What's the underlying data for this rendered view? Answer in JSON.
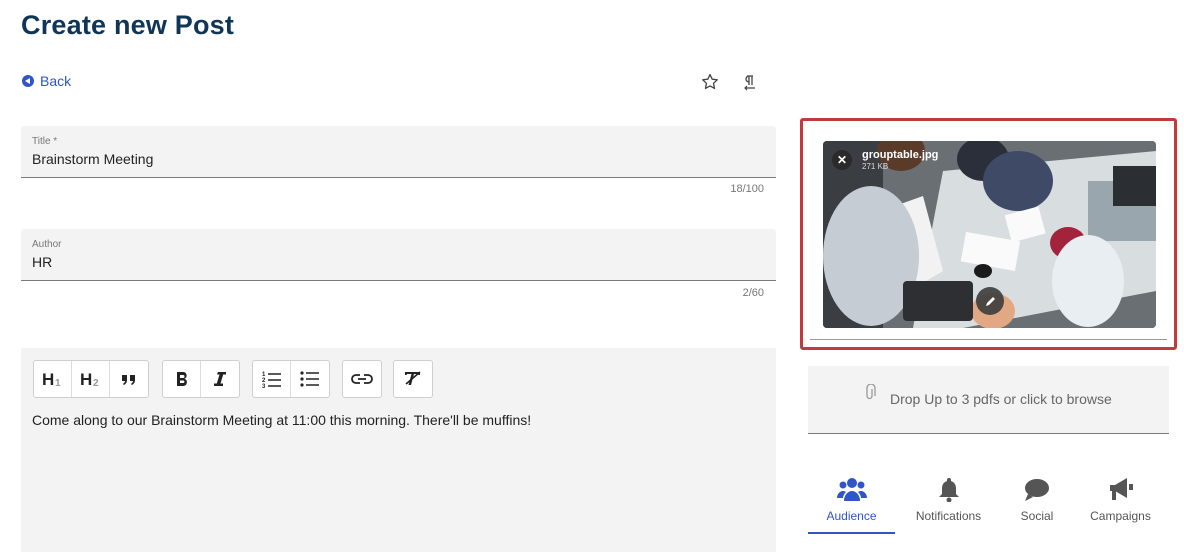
{
  "page": {
    "title": "Create new Post"
  },
  "nav": {
    "back_label": "Back"
  },
  "toolbar_top": {
    "star_icon": "star-outline-icon",
    "paragraph_icon": "paragraph-rtl-icon"
  },
  "form": {
    "title": {
      "label": "Title *",
      "value": "Brainstorm Meeting",
      "counter": "18/100"
    },
    "author": {
      "label": "Author",
      "value": "HR",
      "counter": "2/60"
    }
  },
  "editor": {
    "toolbar": {
      "h1": "H1",
      "h2": "H2",
      "quote": "blockquote",
      "bold": "B",
      "italic": "I",
      "ordered_list": "ordered-list",
      "unordered_list": "bullet-list",
      "link": "link",
      "clear_format": "clear-format"
    },
    "content": "Come along to our Brainstorm Meeting at 11:00 this morning. There'll be muffins!"
  },
  "image": {
    "filename": "grouptable.jpg",
    "size": "271 KB",
    "remove_symbol": "✕"
  },
  "attachments": {
    "dropzone_text": "Drop Up to 3 pdfs or click to browse"
  },
  "tabs": [
    {
      "label": "Audience",
      "active": true
    },
    {
      "label": "Notifications",
      "active": false
    },
    {
      "label": "Social",
      "active": false
    },
    {
      "label": "Campaigns",
      "active": false
    }
  ],
  "colors": {
    "accent": "#2f55c8",
    "title": "#0f3557",
    "highlight_border": "#c13b3b",
    "field_bg": "#f3f3f3"
  }
}
